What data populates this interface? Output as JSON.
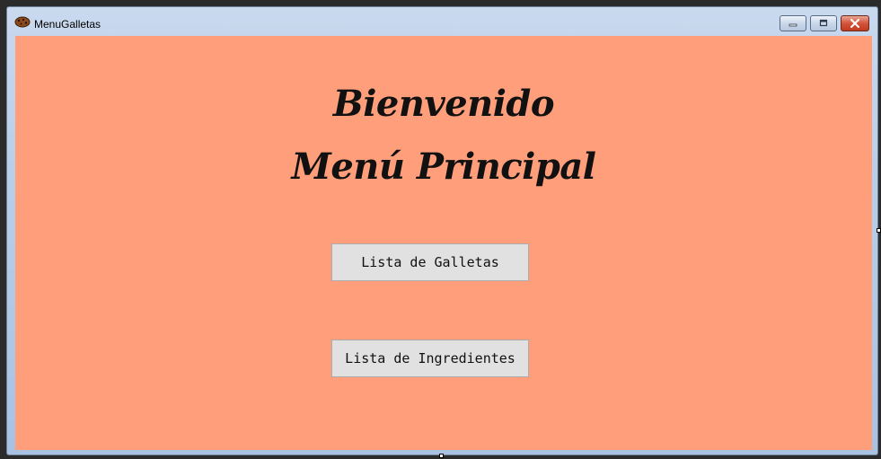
{
  "window": {
    "title": "MenuGalletas",
    "icon": "cookie-app-icon",
    "controls": {
      "minimize": "minimize-icon",
      "maximize": "restore-icon",
      "close": "close-icon"
    }
  },
  "main": {
    "welcome": "Bienvenido",
    "menu_title": "Menú Principal",
    "background_color": "#ff9e7a",
    "buttons": {
      "cookies": "Lista de Galletas",
      "ingredients": "Lista de Ingredientes"
    }
  }
}
